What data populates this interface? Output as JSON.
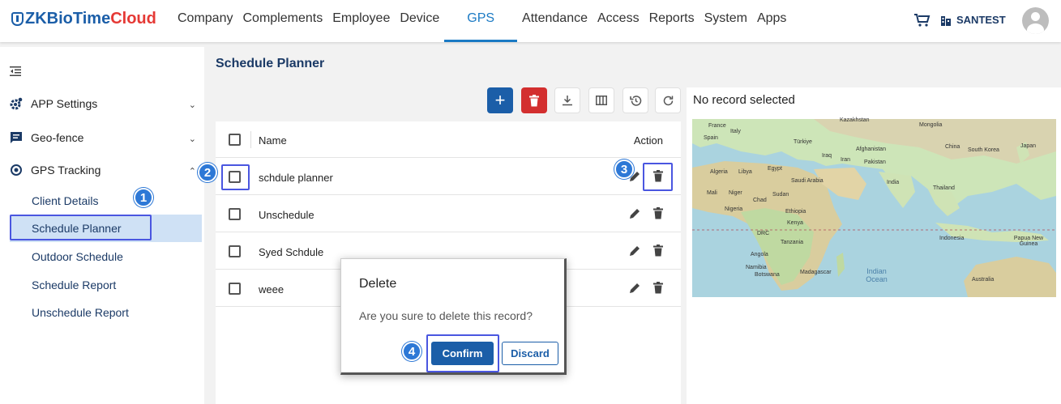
{
  "brand": {
    "prefix": "ZK",
    "middle": "BioTime",
    "suffix": "Cloud"
  },
  "nav": {
    "items": [
      "Company",
      "Complements",
      "Employee",
      "Device",
      "GPS",
      "Attendance",
      "Access",
      "Reports",
      "System",
      "Apps"
    ],
    "active": "GPS"
  },
  "header": {
    "org_name": "SANTEST"
  },
  "sidebar": {
    "groups": [
      {
        "label": "APP Settings",
        "icon": "gear-icon",
        "expanded": false
      },
      {
        "label": "Geo-fence",
        "icon": "message-icon",
        "expanded": false
      },
      {
        "label": "GPS Tracking",
        "icon": "gps-target-icon",
        "expanded": true
      }
    ],
    "subitems": [
      "Client Details",
      "Schedule Planner",
      "Outdoor Schedule",
      "Schedule Report",
      "Unschedule Report"
    ],
    "active_subitem": "Schedule Planner"
  },
  "page": {
    "title": "Schedule Planner"
  },
  "table": {
    "headers": {
      "name": "Name",
      "action": "Action"
    },
    "rows": [
      "schdule planner",
      "Unschedule",
      "Syed Schdule",
      "weee"
    ]
  },
  "right_panel": {
    "status": "No record selected"
  },
  "dialog": {
    "title": "Delete",
    "message": "Are you sure to delete this record?",
    "confirm_label": "Confirm",
    "discard_label": "Discard"
  },
  "annotations": [
    "1",
    "2",
    "3",
    "4"
  ],
  "colors": {
    "primary": "#1b5ea8",
    "danger": "#d32f2f",
    "active_bg": "#cfe1f5",
    "highlight": "#4a56e0",
    "badge": "#2d78d6"
  },
  "map_labels": [
    "Kazakhstan",
    "Mongolia",
    "France",
    "Italy",
    "Spain",
    "Türkiye",
    "China",
    "South Korea",
    "Japan",
    "Afghanistan",
    "Iraq",
    "Iran",
    "Pakistan",
    "Algeria",
    "Libya",
    "Egypt",
    "Saudi Arabia",
    "India",
    "Thailand",
    "Mali",
    "Niger",
    "Chad",
    "Sudan",
    "Nigeria",
    "Ethiopia",
    "Kenya",
    "DRC",
    "Tanzania",
    "Indonesia",
    "Papua New Guinea",
    "Angola",
    "Namibia",
    "Botswana",
    "Madagascar",
    "Indian Ocean",
    "Australia"
  ]
}
